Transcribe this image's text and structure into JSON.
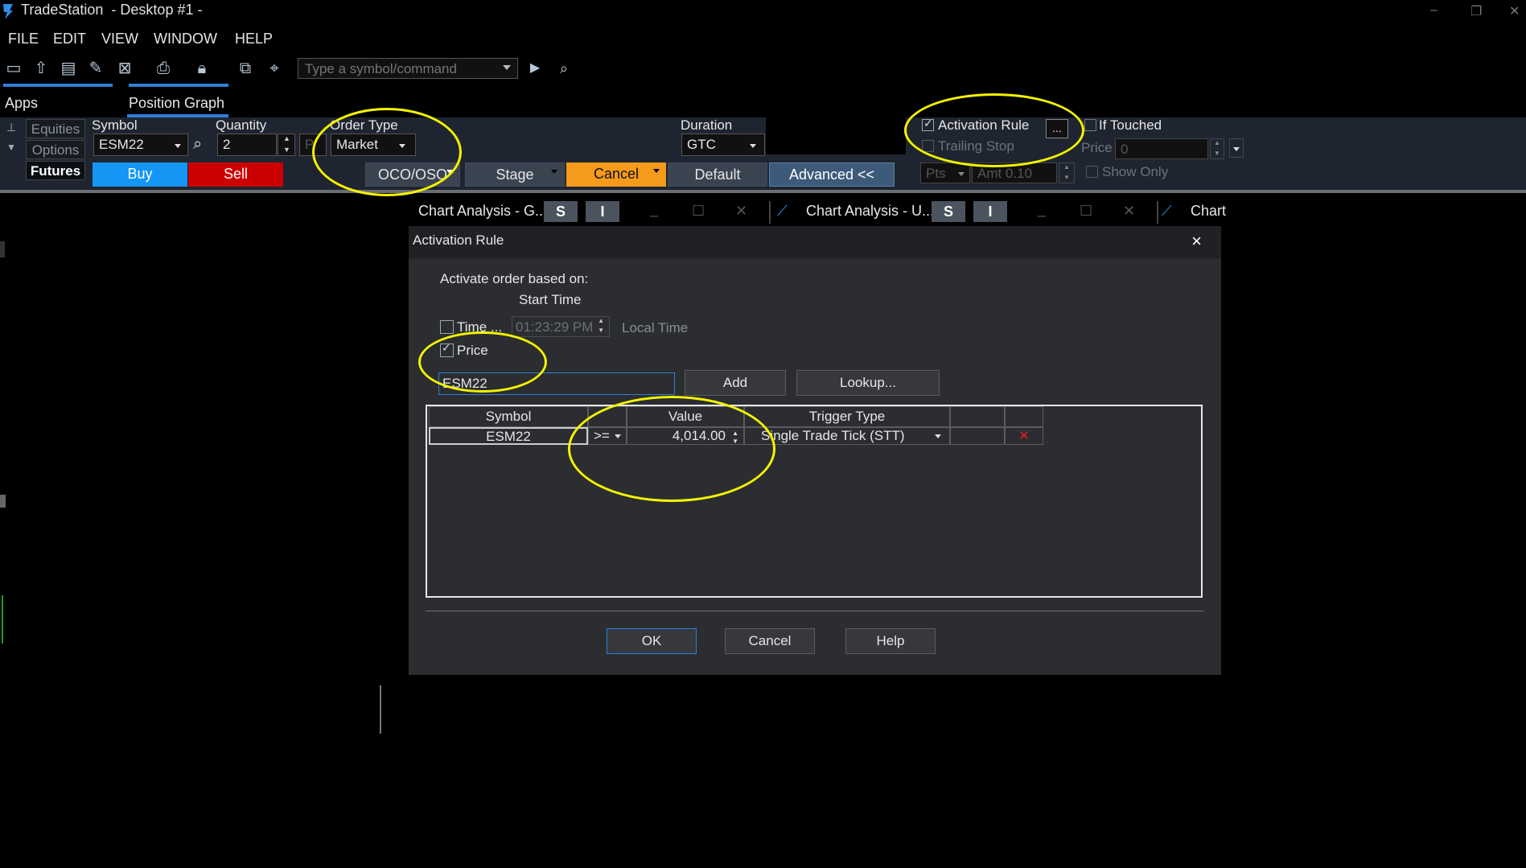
{
  "window": {
    "app_name": "TradeStation",
    "desktop": "- Desktop #1 -"
  },
  "menu": [
    "FILE",
    "EDIT",
    "VIEW",
    "WINDOW",
    "HELP"
  ],
  "toolbar": {
    "command_placeholder": "Type a symbol/command",
    "icons": [
      "new-window-icon",
      "open-icon",
      "save-icon",
      "edit-icon",
      "close-window-icon",
      "print-icon",
      "lock-icon",
      "link-icon",
      "inspect-icon",
      "play-icon",
      "search-icon"
    ]
  },
  "apps_row": {
    "apps_label": "Apps",
    "position_graph": "Position Graph"
  },
  "order_bar": {
    "asset_tabs": [
      "Equities",
      "Options",
      "Futures"
    ],
    "symbol_label": "Symbol",
    "symbol_value": "ESM22",
    "quantity_label": "Quantity",
    "quantity_value": "2",
    "pr_stub": "P",
    "order_type_label": "Order Type",
    "order_type_value": "Market",
    "duration_label": "Duration",
    "duration_value": "GTC",
    "buy_label": "Buy",
    "sell_label": "Sell",
    "oco_label": "OCO/OSO",
    "stage_label": "Stage",
    "cancel_label": "Cancel",
    "default_label": "Default",
    "advanced_label": "Advanced <<",
    "activation_rule_label": "Activation Rule",
    "activation_rule_checked": true,
    "ellipsis": "...",
    "trailing_stop_label": "Trailing Stop",
    "if_touched_label": "If Touched",
    "price_label": "Price",
    "price_value": "0",
    "pts_value": "Pts",
    "amt_value": "Amt 0.10",
    "show_only_label": "Show Only",
    "colors": {
      "buy": "#1596f5",
      "sell": "#cc0000",
      "cancel": "#f59b1c",
      "advanced": "#3d5a7a"
    }
  },
  "window_tabs": [
    {
      "title": "Chart Analysis - G...",
      "s": "S",
      "i": "I"
    },
    {
      "title": "Chart Analysis - U...",
      "s": "S",
      "i": "I"
    },
    {
      "title": "Chart"
    }
  ],
  "dialog": {
    "title": "Activation Rule",
    "close": "×",
    "prompt": "Activate order based on:",
    "start_time_label": "Start Time",
    "time_label": "Time ...",
    "time_checked": false,
    "time_value": "01:23:29 PM",
    "local_time_label": "Local Time",
    "price_label": "Price",
    "price_checked": true,
    "symbol_input": "ESM22",
    "add_label": "Add",
    "lookup_label": "Lookup...",
    "table": {
      "headers": [
        "Symbol",
        "",
        "Value",
        "Trigger Type",
        "",
        ""
      ],
      "rows": [
        {
          "symbol": "ESM22",
          "operator": ">=",
          "value": "4,014.00",
          "trigger_type": "Single Trade Tick (STT)",
          "delete": "✕"
        }
      ]
    },
    "ok_label": "OK",
    "cancel_label": "Cancel",
    "help_label": "Help"
  },
  "annotation_color": "#f3f300"
}
